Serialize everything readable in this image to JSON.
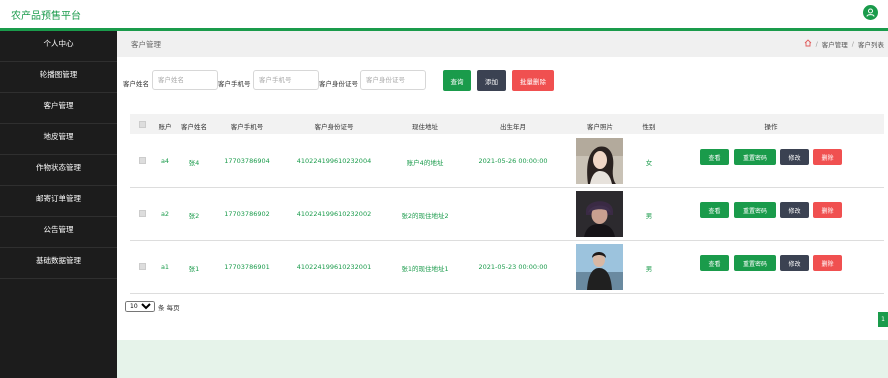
{
  "header": {
    "title": "农产品预售平台",
    "user_icon": "user-icon",
    "accent": "#1a9b4b"
  },
  "sidebar": {
    "items": [
      {
        "label": "个人中心"
      },
      {
        "label": "轮播图管理"
      },
      {
        "label": "客户管理"
      },
      {
        "label": "地皮管理"
      },
      {
        "label": "作物状态管理"
      },
      {
        "label": "邮寄订单管理"
      },
      {
        "label": "公告管理"
      },
      {
        "label": "基础数据管理"
      }
    ]
  },
  "breadcrumb": {
    "page_title": "客户管理",
    "home_icon": "home-icon",
    "level1": "客户管理",
    "level2": "客户列表"
  },
  "search": {
    "name_label": "客户姓名",
    "name_placeholder": "客户姓名",
    "phone_label": "客户手机号",
    "phone_placeholder": "客户手机号",
    "id_label": "客户身份证号",
    "id_placeholder": "客户身份证号",
    "query_btn": "查询",
    "add_btn": "添加",
    "batch_delete_btn": "批量删除"
  },
  "table": {
    "columns": [
      "账户",
      "客户姓名",
      "客户手机号",
      "客户身份证号",
      "现住地址",
      "出生年月",
      "客户照片",
      "性别",
      "操作"
    ],
    "actions": {
      "view": "查看",
      "reset_pwd": "重置密码",
      "edit": "修改",
      "delete": "删除"
    },
    "rows": [
      {
        "account": "a4",
        "name": "张4",
        "phone": "17703786904",
        "id_number": "410224199610232004",
        "address": "账户4的地址",
        "birth": "2021-05-26 00:00:00",
        "gender": "女"
      },
      {
        "account": "a2",
        "name": "张2",
        "phone": "17703786902",
        "id_number": "410224199610232002",
        "address": "张2的现住地址2",
        "birth": "",
        "gender": "男"
      },
      {
        "account": "a1",
        "name": "张1",
        "phone": "17703786901",
        "id_number": "410224199610232001",
        "address": "张1的现住地址1",
        "birth": "2021-05-23 00:00:00",
        "gender": "男"
      }
    ]
  },
  "pagination": {
    "page_size": "10",
    "per_page_text": "条 每页",
    "current_page": "1"
  }
}
